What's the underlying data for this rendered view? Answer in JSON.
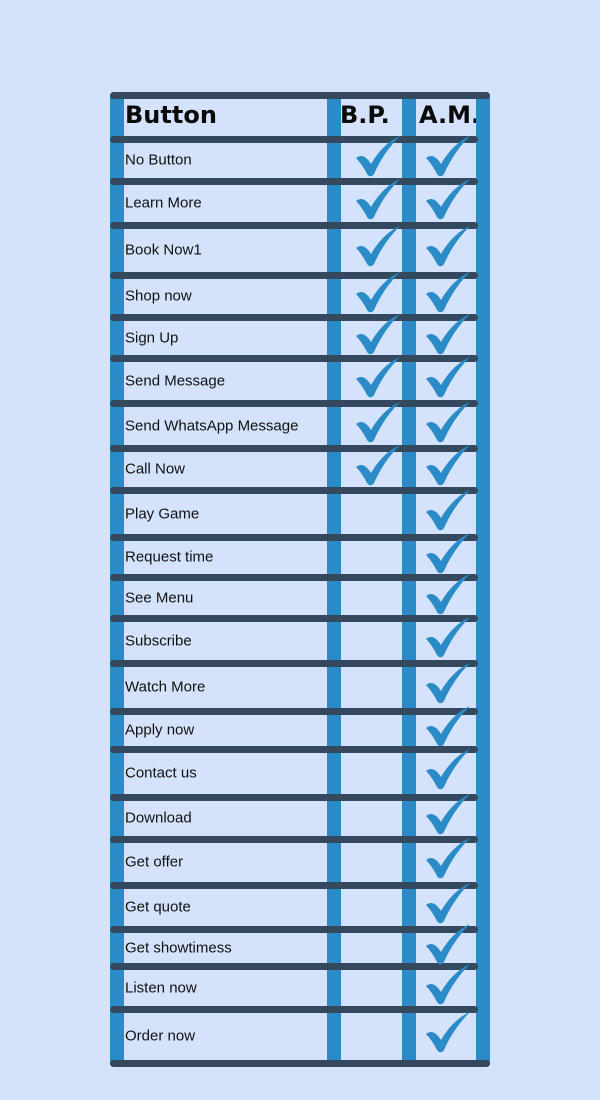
{
  "colors": {
    "background": "#d4e3fb",
    "column_bar": "#2a8bc7",
    "row_bar": "#34495e",
    "check": "#2a8bc7",
    "text": "#111111"
  },
  "table": {
    "headers": {
      "button": "Button",
      "bp": "B.P.",
      "am": "A.M."
    },
    "check_icon": "checkmark-icon",
    "rows": [
      {
        "label": "No Button",
        "bp": true,
        "am": true
      },
      {
        "label": "Learn More",
        "bp": true,
        "am": true
      },
      {
        "label": "Book Now1",
        "bp": true,
        "am": true
      },
      {
        "label": "Shop now",
        "bp": true,
        "am": true
      },
      {
        "label": "Sign Up",
        "bp": true,
        "am": true
      },
      {
        "label": "Send Message",
        "bp": true,
        "am": true
      },
      {
        "label": "Send WhatsApp Message",
        "bp": true,
        "am": true
      },
      {
        "label": "Call Now",
        "bp": true,
        "am": true
      },
      {
        "label": "Play Game",
        "bp": false,
        "am": true
      },
      {
        "label": "Request time",
        "bp": false,
        "am": true
      },
      {
        "label": "See Menu",
        "bp": false,
        "am": true
      },
      {
        "label": "Subscribe",
        "bp": false,
        "am": true
      },
      {
        "label": "Watch More",
        "bp": false,
        "am": true
      },
      {
        "label": "Apply now",
        "bp": false,
        "am": true
      },
      {
        "label": "Contact us",
        "bp": false,
        "am": true
      },
      {
        "label": "Download",
        "bp": false,
        "am": true
      },
      {
        "label": "Get offer",
        "bp": false,
        "am": true
      },
      {
        "label": "Get quote",
        "bp": false,
        "am": true
      },
      {
        "label": "Get showtimess",
        "bp": false,
        "am": true
      },
      {
        "label": "Listen now",
        "bp": false,
        "am": true
      },
      {
        "label": "Order now",
        "bp": false,
        "am": true
      }
    ]
  }
}
